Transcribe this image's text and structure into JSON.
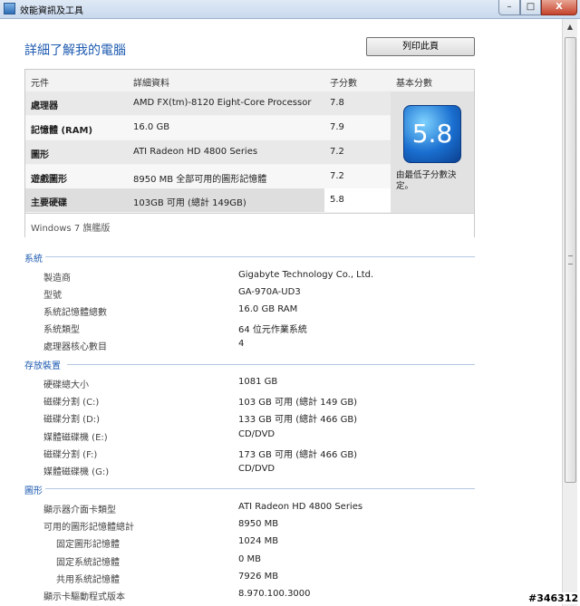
{
  "window": {
    "title": "效能資訊及工具",
    "min_glyph": "–",
    "max_glyph": "□",
    "close_glyph": "X"
  },
  "header": {
    "title": "詳細了解我的電腦",
    "print_label": "列印此頁"
  },
  "scores": {
    "columns": [
      "元件",
      "詳細資料",
      "子分數",
      "基本分數"
    ],
    "rows": [
      {
        "component": "處理器",
        "detail": "AMD FX(tm)-8120 Eight-Core Processor",
        "subscore": "7.8"
      },
      {
        "component": "記憶體 (RAM)",
        "detail": "16.0 GB",
        "subscore": "7.9"
      },
      {
        "component": "圖形",
        "detail": "ATI Radeon HD 4800 Series",
        "subscore": "7.2"
      },
      {
        "component": "遊戲圖形",
        "detail": "8950 MB 全部可用的圖形記憶體",
        "subscore": "7.2"
      },
      {
        "component": "主要硬碟",
        "detail": "103GB 可用 (總計 149GB)",
        "subscore": "5.8"
      }
    ],
    "base_score": "5.8",
    "base_note": "由最低子分數決定。",
    "edition": "Windows 7 旗艦版"
  },
  "sections": [
    {
      "title": "系統",
      "items": [
        {
          "label": "製造商",
          "value": "Gigabyte Technology Co., Ltd."
        },
        {
          "label": "型號",
          "value": "GA-970A-UD3"
        },
        {
          "label": "系統記憶體總數",
          "value": "16.0 GB RAM"
        },
        {
          "label": "系統類型",
          "value": "64 位元作業系統"
        },
        {
          "label": "處理器核心數目",
          "value": "4"
        }
      ]
    },
    {
      "title": "存放裝置",
      "items": [
        {
          "label": "硬碟總大小",
          "value": "1081 GB"
        },
        {
          "label": "磁碟分割 (C:)",
          "value": "103 GB 可用 (總計 149 GB)"
        },
        {
          "label": "磁碟分割 (D:)",
          "value": "133 GB 可用 (總計 466 GB)"
        },
        {
          "label": "媒體磁碟機 (E:)",
          "value": "CD/DVD"
        },
        {
          "label": "磁碟分割 (F:)",
          "value": "173 GB 可用 (總計 466 GB)"
        },
        {
          "label": "媒體磁碟機 (G:)",
          "value": "CD/DVD"
        }
      ]
    },
    {
      "title": "圖形",
      "items": [
        {
          "label": "顯示器介面卡類型",
          "value": "ATI Radeon HD 4800 Series"
        },
        {
          "label": "可用的圖形記憶體總計",
          "value": "8950 MB"
        },
        {
          "label": "固定圖形記憶體",
          "value": "1024 MB"
        },
        {
          "label": "固定系統記憶體",
          "value": "0 MB"
        },
        {
          "label": "共用系統記憶體",
          "value": "7926 MB"
        },
        {
          "label": "顯示卡驅動程式版本",
          "value": "8.970.100.3000"
        }
      ]
    }
  ],
  "watermark": "#346312"
}
